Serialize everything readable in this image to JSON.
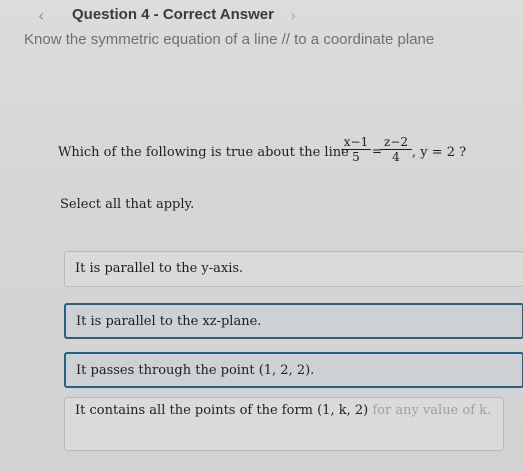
{
  "header": {
    "prev_icon": "chevron-left-icon",
    "prev_glyph": "‹",
    "title": "Question 4 - Correct Answer",
    "next_icon": "chevron-right-icon",
    "next_glyph": "›"
  },
  "topic": "Know the symmetric equation of a line // to a coordinate plane",
  "question": {
    "prefix": "Which of the following is true about the line",
    "frac1_num": "x−1",
    "frac1_den": "5",
    "eq": "=",
    "frac2_num": "z−2",
    "frac2_den": "4",
    "suffix": ", y = 2 ?"
  },
  "instruction": "Select all that apply.",
  "options": [
    {
      "label": "It is parallel to the y-axis.",
      "selected": false
    },
    {
      "label": "It is parallel to the xz-plane.",
      "selected": true
    },
    {
      "label": "It passes through the point (1, 2, 2).",
      "selected": true
    },
    {
      "label": "It contains all the points of the form (1, k, 2)",
      "hint": " for any value of k.",
      "selected": false
    }
  ],
  "colors": {
    "selected_border": "#2e5f78",
    "background": "#d6d6d6"
  }
}
